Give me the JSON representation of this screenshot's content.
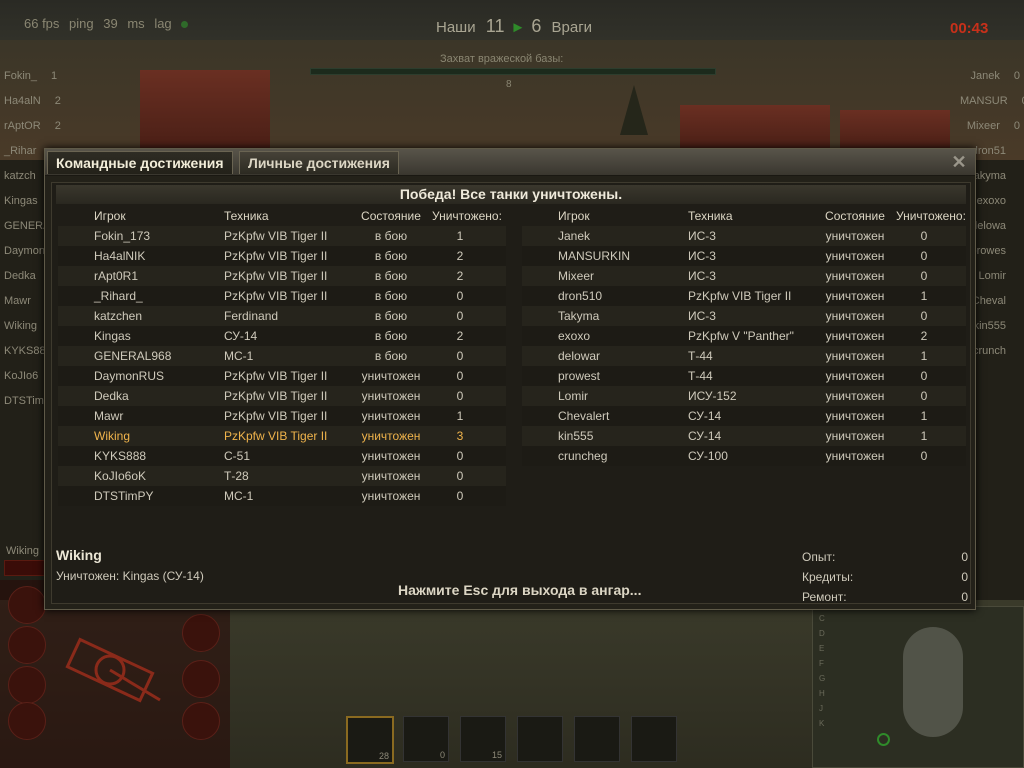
{
  "hud": {
    "fps": "66 fps",
    "ping": "ping",
    "ping_value": "39",
    "ms": "ms",
    "lag": "lag",
    "team_ours": "Наши",
    "score_ours": "11",
    "score_theirs": "6",
    "team_enemy": "Враги",
    "timer": "00:43",
    "capture_label": "Захват вражеской базы:",
    "capture_value": "8",
    "player_name": "Wiking"
  },
  "left_side_list": [
    {
      "name": "Fokin_",
      "n": "1"
    },
    {
      "name": "Ha4alN",
      "n": "2"
    },
    {
      "name": "rAptOR",
      "n": "2"
    },
    {
      "name": "_Rihar",
      "n": ""
    },
    {
      "name": "katzch",
      "n": ""
    },
    {
      "name": "Kingas",
      "n": ""
    },
    {
      "name": "GENERA",
      "n": ""
    },
    {
      "name": "Daymon",
      "n": ""
    },
    {
      "name": "Dedka",
      "n": ""
    },
    {
      "name": "Mawr",
      "n": ""
    },
    {
      "name": "Wiking",
      "n": ""
    },
    {
      "name": "KYKS88",
      "n": ""
    },
    {
      "name": "KoJIo6",
      "n": ""
    },
    {
      "name": "DTSTim",
      "n": ""
    }
  ],
  "right_side_list": [
    {
      "name": "Janek",
      "n": "0"
    },
    {
      "name": "MANSUR",
      "n": "0"
    },
    {
      "name": "Mixeer",
      "n": "0"
    },
    {
      "name": "dron51",
      "n": ""
    },
    {
      "name": "Takyma",
      "n": ""
    },
    {
      "name": "exoxo",
      "n": ""
    },
    {
      "name": "delowa",
      "n": ""
    },
    {
      "name": "prowes",
      "n": ""
    },
    {
      "name": "Lomir",
      "n": ""
    },
    {
      "name": "Cheval",
      "n": ""
    },
    {
      "name": "kin555",
      "n": ""
    },
    {
      "name": "crunch",
      "n": ""
    }
  ],
  "ammo": [
    {
      "count": "28",
      "selected": true
    },
    {
      "count": "0",
      "selected": false
    },
    {
      "count": "15",
      "selected": false
    },
    {
      "count": "",
      "selected": false
    },
    {
      "count": "",
      "selected": false
    },
    {
      "count": "",
      "selected": false
    }
  ],
  "minimap_letters": [
    "C",
    "D",
    "E",
    "F",
    "G",
    "H",
    "J",
    "K"
  ],
  "dialog": {
    "tab_team": "Командные достижения",
    "tab_personal": "Личные достижения",
    "close_glyph": "✕",
    "result": "Победа! Все танки уничтожены.",
    "columns": {
      "player": "Игрок",
      "tank": "Техника",
      "status": "Состояние",
      "kills": "Уничтожено:"
    },
    "team_left": [
      {
        "player": "Fokin_173",
        "tank": "PzKpfw VIB Tiger II",
        "status": "в бою",
        "kills": "1",
        "me": false
      },
      {
        "player": "Ha4alNIK",
        "tank": "PzKpfw VIB Tiger II",
        "status": "в бою",
        "kills": "2",
        "me": false
      },
      {
        "player": "rApt0R1",
        "tank": "PzKpfw VIB Tiger II",
        "status": "в бою",
        "kills": "2",
        "me": false
      },
      {
        "player": "_Rihard_",
        "tank": "PzKpfw VIB Tiger II",
        "status": "в бою",
        "kills": "0",
        "me": false
      },
      {
        "player": "katzchen",
        "tank": "Ferdinand",
        "status": "в бою",
        "kills": "0",
        "me": false
      },
      {
        "player": "Kingas",
        "tank": "СУ-14",
        "status": "в бою",
        "kills": "2",
        "me": false
      },
      {
        "player": "GENERAL968",
        "tank": "МС-1",
        "status": "в бою",
        "kills": "0",
        "me": false
      },
      {
        "player": "DaymonRUS",
        "tank": "PzKpfw VIB Tiger II",
        "status": "уничтожен",
        "kills": "0",
        "me": false
      },
      {
        "player": "Dedka",
        "tank": "PzKpfw VIB Tiger II",
        "status": "уничтожен",
        "kills": "0",
        "me": false
      },
      {
        "player": "Mawr",
        "tank": "PzKpfw VIB Tiger II",
        "status": "уничтожен",
        "kills": "1",
        "me": false
      },
      {
        "player": "Wiking",
        "tank": "PzKpfw VIB Tiger II",
        "status": "уничтожен",
        "kills": "3",
        "me": true
      },
      {
        "player": "KYKS888",
        "tank": "С-51",
        "status": "уничтожен",
        "kills": "0",
        "me": false
      },
      {
        "player": "KoJIo6oK",
        "tank": "Т-28",
        "status": "уничтожен",
        "kills": "0",
        "me": false
      },
      {
        "player": "DTSTimPY",
        "tank": "МС-1",
        "status": "уничтожен",
        "kills": "0",
        "me": false
      }
    ],
    "team_right": [
      {
        "player": "Janek",
        "tank": "ИС-3",
        "status": "уничтожен",
        "kills": "0",
        "me": false
      },
      {
        "player": "MANSURKIN",
        "tank": "ИС-3",
        "status": "уничтожен",
        "kills": "0",
        "me": false
      },
      {
        "player": "Mixeer",
        "tank": "ИС-3",
        "status": "уничтожен",
        "kills": "0",
        "me": false
      },
      {
        "player": "dron510",
        "tank": "PzKpfw VIB Tiger II",
        "status": "уничтожен",
        "kills": "1",
        "me": false
      },
      {
        "player": "Takyma",
        "tank": "ИС-3",
        "status": "уничтожен",
        "kills": "0",
        "me": false
      },
      {
        "player": "exoxo",
        "tank": "PzKpfw V \"Panther\"",
        "status": "уничтожен",
        "kills": "2",
        "me": false
      },
      {
        "player": "delowar",
        "tank": "Т-44",
        "status": "уничтожен",
        "kills": "1",
        "me": false
      },
      {
        "player": "prowest",
        "tank": "Т-44",
        "status": "уничтожен",
        "kills": "0",
        "me": false
      },
      {
        "player": "Lomir",
        "tank": "ИСУ-152",
        "status": "уничтожен",
        "kills": "0",
        "me": false
      },
      {
        "player": "Chevalert",
        "tank": "СУ-14",
        "status": "уничтожен",
        "kills": "1",
        "me": false
      },
      {
        "player": "kin555",
        "tank": "СУ-14",
        "status": "уничтожен",
        "kills": "1",
        "me": false
      },
      {
        "player": "cruncheg",
        "tank": "СУ-100",
        "status": "уничтожен",
        "kills": "0",
        "me": false
      }
    ],
    "footer": {
      "player_name": "Wiking",
      "killed_by": "Уничтожен: Kingas (СУ-14)",
      "esc_hint": "Нажмите Esc для выхода в ангар...",
      "stats": [
        {
          "label": "Опыт:",
          "value": "0"
        },
        {
          "label": "Кредиты:",
          "value": "0"
        },
        {
          "label": "Ремонт:",
          "value": "0"
        }
      ]
    }
  }
}
